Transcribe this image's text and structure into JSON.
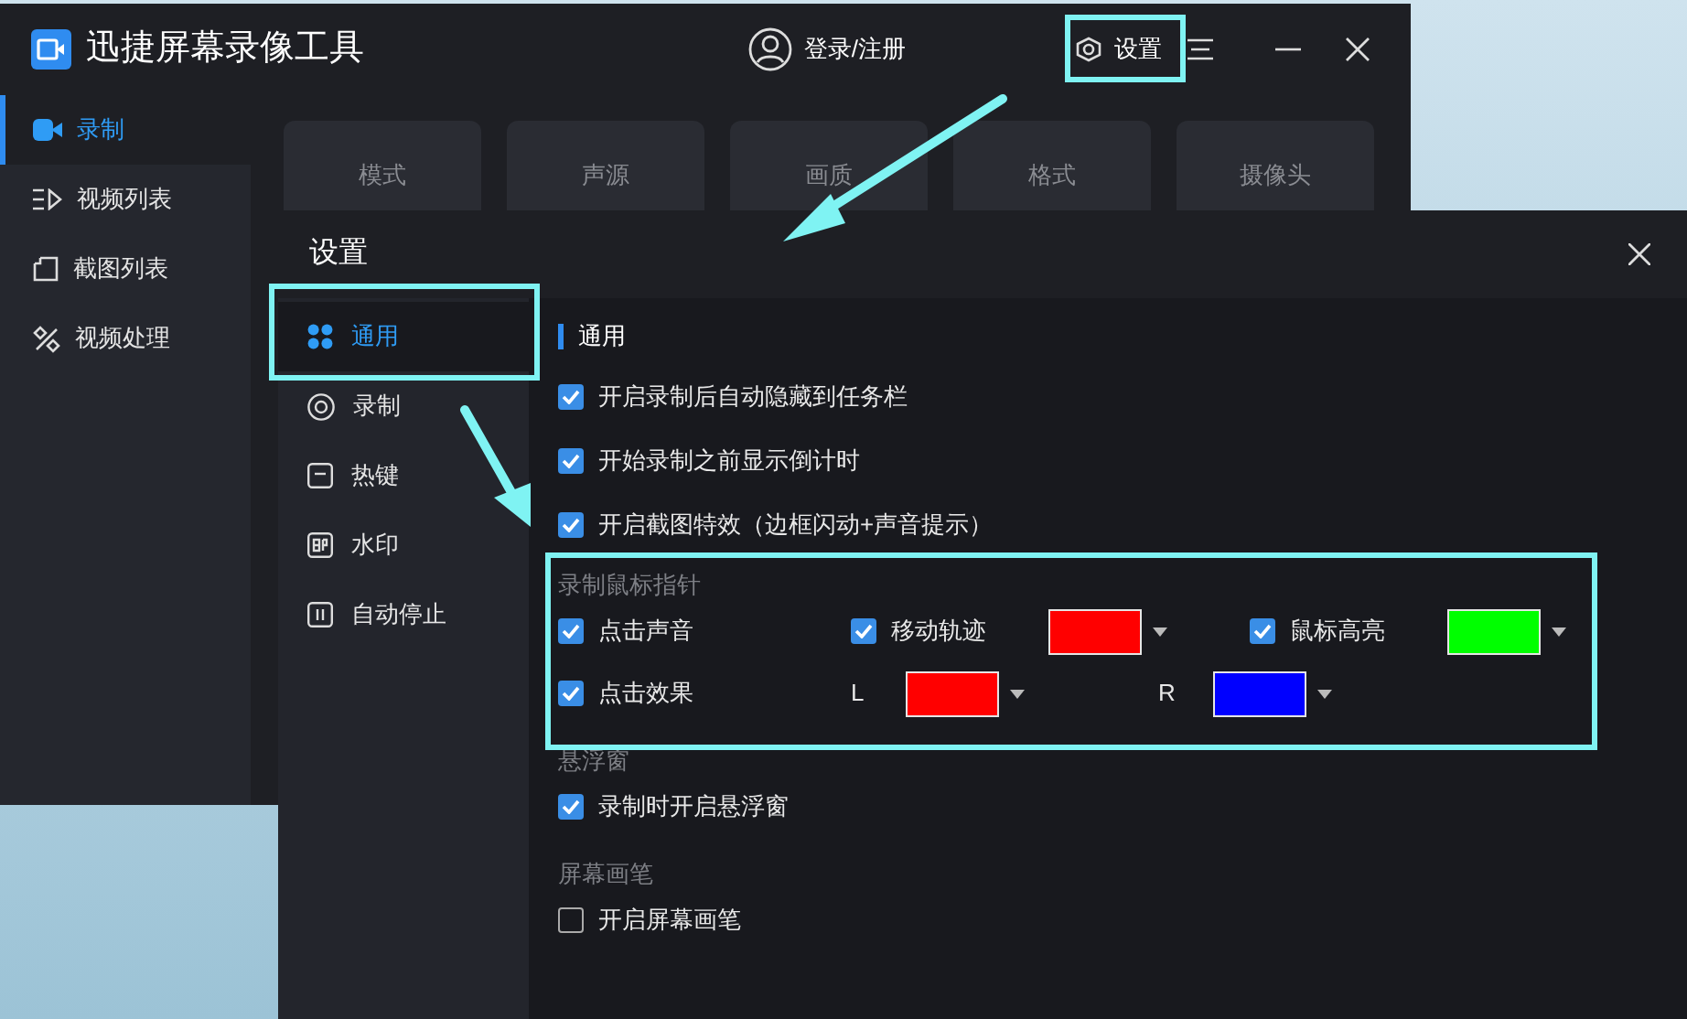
{
  "app_window": {
    "title": "迅捷屏幕录像工具",
    "login": "登录/注册",
    "settings_button": "设置",
    "sidebar": [
      {
        "label": "录制",
        "selected": true
      },
      {
        "label": "视频列表",
        "selected": false
      },
      {
        "label": "截图列表",
        "selected": false
      },
      {
        "label": "视频处理",
        "selected": false
      }
    ],
    "tabs": [
      "模式",
      "声源",
      "画质",
      "格式",
      "摄像头"
    ]
  },
  "settings_dialog": {
    "title": "设置",
    "nav": [
      {
        "label": "通用",
        "selected": true
      },
      {
        "label": "录制",
        "selected": false
      },
      {
        "label": "热键",
        "selected": false
      },
      {
        "label": "水印",
        "selected": false
      },
      {
        "label": "自动停止",
        "selected": false
      }
    ],
    "sections": [
      {
        "heading": "通用",
        "kind": "main",
        "rows": [
          [
            {
              "kind": "checkbox",
              "label": "开启录制后自动隐藏到任务栏",
              "checked": true
            }
          ],
          [
            {
              "kind": "checkbox",
              "label": "开始录制之前显示倒计时",
              "checked": true
            }
          ],
          [
            {
              "kind": "checkbox",
              "label": "开启截图特效（边框闪动+声音提示）",
              "checked": true
            }
          ]
        ]
      },
      {
        "heading": "录制鼠标指针",
        "kind": "sub",
        "rows": [
          [
            {
              "kind": "checkbox",
              "label": "点击声音",
              "checked": true
            },
            {
              "kind": "checkbox",
              "label": "移动轨迹",
              "checked": true,
              "color": "#ff0000"
            },
            {
              "kind": "checkbox",
              "label": "鼠标高亮",
              "checked": true,
              "color": "#00ff00"
            }
          ],
          [
            {
              "kind": "checkbox",
              "label": "点击效果",
              "checked": true
            },
            {
              "kind": "swatch",
              "label": "L",
              "color": "#ff0000"
            },
            {
              "kind": "swatch",
              "label": "R",
              "color": "#0000ff"
            }
          ]
        ]
      },
      {
        "heading": "悬浮窗",
        "kind": "sub",
        "rows": [
          [
            {
              "kind": "checkbox",
              "label": "录制时开启悬浮窗",
              "checked": true
            }
          ]
        ]
      },
      {
        "heading": "屏幕画笔",
        "kind": "sub",
        "rows": [
          [
            {
              "kind": "checkbox",
              "label": "开启屏幕画笔",
              "checked": false
            }
          ]
        ]
      }
    ]
  }
}
